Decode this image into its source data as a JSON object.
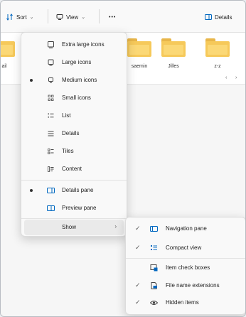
{
  "toolbar": {
    "sort_label": "Sort",
    "view_label": "View",
    "more_label": "•••",
    "details_label": "Details"
  },
  "files": [
    {
      "name": "ail"
    },
    {
      "name": "saemin"
    },
    {
      "name": "Jilles"
    },
    {
      "name": "z-z"
    }
  ],
  "view_menu": {
    "items": [
      {
        "label": "Extra large icons",
        "icon": "extra-large-icons-icon",
        "selected": false
      },
      {
        "label": "Large icons",
        "icon": "large-icons-icon",
        "selected": false
      },
      {
        "label": "Medium icons",
        "icon": "medium-icons-icon",
        "selected": true
      },
      {
        "label": "Small icons",
        "icon": "small-icons-icon",
        "selected": false
      },
      {
        "label": "List",
        "icon": "list-icon",
        "selected": false
      },
      {
        "label": "Details",
        "icon": "details-icon",
        "selected": false
      },
      {
        "label": "Tiles",
        "icon": "tiles-icon",
        "selected": false
      },
      {
        "label": "Content",
        "icon": "content-icon",
        "selected": false
      }
    ],
    "panes": [
      {
        "label": "Details pane",
        "icon": "details-pane-icon",
        "selected": true
      },
      {
        "label": "Preview pane",
        "icon": "preview-pane-icon",
        "selected": false
      }
    ],
    "show_label": "Show",
    "show_arrow": "›"
  },
  "show_submenu": {
    "items": [
      {
        "label": "Navigation pane",
        "icon": "navigation-pane-icon",
        "checked": true
      },
      {
        "label": "Compact view",
        "icon": "compact-view-icon",
        "checked": true
      },
      {
        "label": "Item check boxes",
        "icon": "item-check-boxes-icon",
        "checked": false
      },
      {
        "label": "File name extensions",
        "icon": "file-name-extensions-icon",
        "checked": true
      },
      {
        "label": "Hidden items",
        "icon": "hidden-items-icon",
        "checked": true
      }
    ]
  },
  "colors": {
    "accent": "#0067c0",
    "folder": "#f6c95a"
  }
}
